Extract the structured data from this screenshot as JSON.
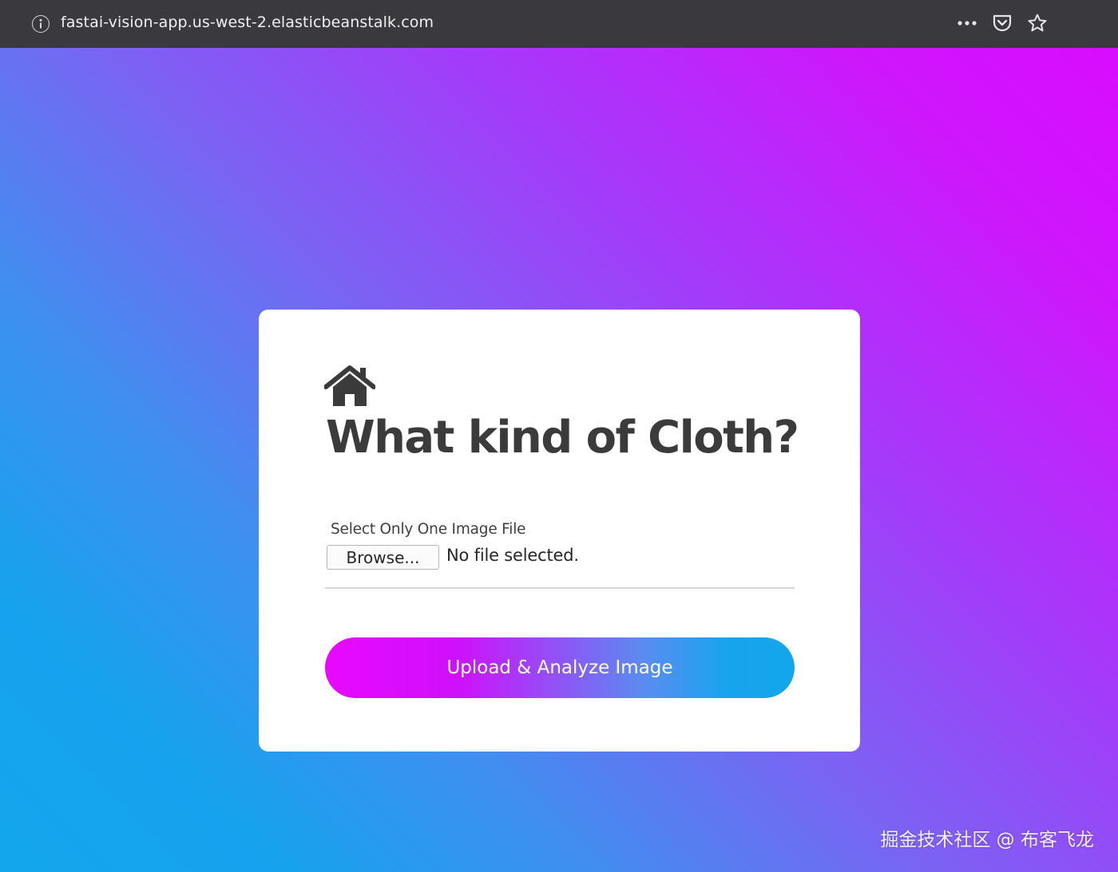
{
  "browser": {
    "url": "fastai-vision-app.us-west-2.elasticbeanstalk.com",
    "icons": [
      "info-icon",
      "more-actions-icon",
      "pocket-icon",
      "bookmark-star-icon"
    ]
  },
  "card": {
    "icon": "home-icon",
    "title": "What kind of Cloth?",
    "field_label": "Select Only One Image File",
    "browse_label": "Browse...",
    "file_status": "No file selected.",
    "upload_label": "Upload & Analyze Image"
  },
  "watermark": "掘金技术社区 @ 布客飞龙",
  "colors": {
    "toolbar": "#3a393d",
    "gradient_magenta": "#d90cff",
    "gradient_blue": "#13a6ed",
    "title_text": "#3b3b3c",
    "card_bg": "#ffffff"
  }
}
